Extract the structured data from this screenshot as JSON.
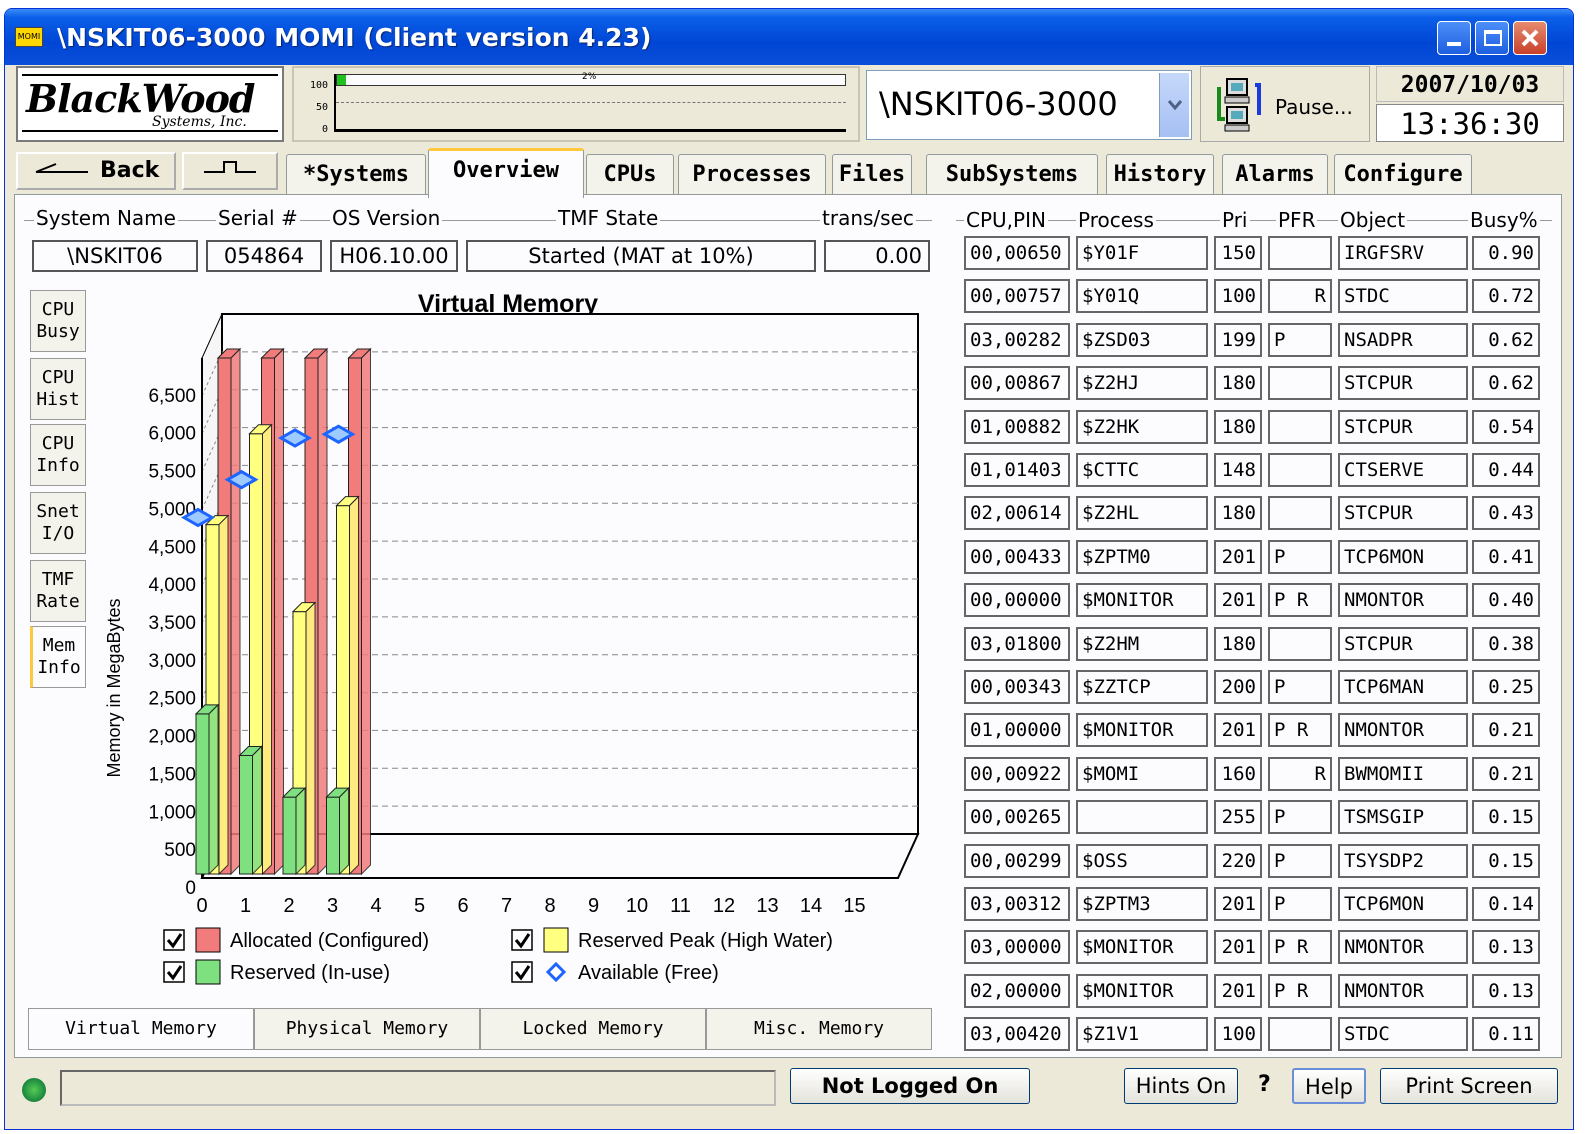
{
  "window": {
    "title": "\\NSKIT06-3000 MOMI (Client version 4.23)"
  },
  "logo": {
    "text": "BlackWood",
    "sub": "Systems, Inc."
  },
  "mini_chart": {
    "yticks": [
      "100",
      "50",
      "0"
    ],
    "label": "2%"
  },
  "system_select": {
    "value": "\\NSKIT06-3000"
  },
  "pause_button": {
    "label": "Pause..."
  },
  "clock": {
    "date": "2007/10/03",
    "time": "13:36:30"
  },
  "nav": {
    "back": "Back",
    "forward": ""
  },
  "tabs": [
    "*Systems",
    "Overview",
    "CPUs",
    "Processes",
    "Files",
    "SubSystems",
    "History",
    "Alarms",
    "Configure"
  ],
  "active_tab": "Overview",
  "summary": {
    "headers": {
      "system_name": "System Name",
      "serial": "Serial #",
      "os_version": "OS Version",
      "tmf_state": "TMF State",
      "trans_sec": "trans/sec"
    },
    "values": {
      "system_name": "\\NSKIT06",
      "serial": "054864",
      "os_version": "H06.10.00",
      "tmf_state": "Started (MAT at 10%)",
      "trans_sec": "0.00"
    }
  },
  "side_tabs": [
    {
      "l1": "CPU",
      "l2": "Busy"
    },
    {
      "l1": "CPU",
      "l2": "Hist"
    },
    {
      "l1": "CPU",
      "l2": "Info"
    },
    {
      "l1": "Snet",
      "l2": "I/O"
    },
    {
      "l1": "TMF",
      "l2": "Rate"
    },
    {
      "l1": "Mem",
      "l2": "Info"
    }
  ],
  "chart_data": {
    "type": "bar",
    "title": "Virtual Memory",
    "ylabel": "Memory in MegaBytes",
    "xlabel": "",
    "categories": [
      "0",
      "1",
      "2",
      "3",
      "4",
      "5",
      "6",
      "7",
      "8",
      "9",
      "10",
      "11",
      "12",
      "13",
      "14",
      "15"
    ],
    "ylim": [
      0,
      7000
    ],
    "yticks": [
      "0",
      "500",
      "1,000",
      "1,500",
      "2,000",
      "2,500",
      "3,000",
      "3,500",
      "4,000",
      "4,500",
      "5,000",
      "5,500",
      "6,000",
      "6,500"
    ],
    "grid": true,
    "series": [
      {
        "name": "Allocated (Configured)",
        "color": "#f27b7b",
        "values": [
          7000,
          7000,
          7000,
          7000
        ]
      },
      {
        "name": "Reserved Peak (High Water)",
        "color": "#ffff80",
        "values": [
          4800,
          6000,
          3650,
          5050
        ]
      },
      {
        "name": "Reserved (In-use)",
        "color": "#7ee07e",
        "values": [
          2300,
          1750,
          1200,
          1200
        ]
      },
      {
        "name": "Available (Free)",
        "color": "#1e64ff",
        "values": [
          4550,
          5050,
          5600,
          5650
        ]
      }
    ],
    "legend": [
      {
        "label": "Allocated (Configured)",
        "checked": true
      },
      {
        "label": "Reserved Peak (High Water)",
        "checked": true
      },
      {
        "label": "Reserved (In-use)",
        "checked": true
      },
      {
        "label": "Available (Free)",
        "checked": true
      }
    ]
  },
  "memory_tabs": [
    "Virtual Memory",
    "Physical Memory",
    "Locked Memory",
    "Misc. Memory"
  ],
  "process_table": {
    "columns": [
      "CPU,PIN",
      "Process",
      "Pri",
      "PFR",
      "Object",
      "Busy%"
    ],
    "rows": [
      [
        "00,00650",
        "$Y01F",
        "150",
        "",
        "IRGFSRV",
        "0.90"
      ],
      [
        "00,00757",
        "$Y01Q",
        "100",
        "R",
        "STDC",
        "0.72"
      ],
      [
        "03,00282",
        "$ZSD03",
        "199",
        "P",
        "NSADPR",
        "0.62"
      ],
      [
        "00,00867",
        "$Z2HJ",
        "180",
        "",
        "STCPUR",
        "0.62"
      ],
      [
        "01,00882",
        "$Z2HK",
        "180",
        "",
        "STCPUR",
        "0.54"
      ],
      [
        "01,01403",
        "$CTTC",
        "148",
        "",
        "CTSERVE",
        "0.44"
      ],
      [
        "02,00614",
        "$Z2HL",
        "180",
        "",
        "STCPUR",
        "0.43"
      ],
      [
        "00,00433",
        "$ZPTM0",
        "201",
        "P",
        "TCP6MON",
        "0.41"
      ],
      [
        "00,00000",
        "$MONITOR",
        "201",
        "P R",
        "NMONTOR",
        "0.40"
      ],
      [
        "03,01800",
        "$Z2HM",
        "180",
        "",
        "STCPUR",
        "0.38"
      ],
      [
        "00,00343",
        "$ZZTCP",
        "200",
        "P",
        "TCP6MAN",
        "0.25"
      ],
      [
        "01,00000",
        "$MONITOR",
        "201",
        "P R",
        "NMONTOR",
        "0.21"
      ],
      [
        "00,00922",
        "$MOMI",
        "160",
        "R",
        "BWMOMII",
        "0.21"
      ],
      [
        "00,00265",
        "",
        "255",
        "P",
        "TSMSGIP",
        "0.15"
      ],
      [
        "00,00299",
        "$OSS",
        "220",
        "P",
        "TSYSDP2",
        "0.15"
      ],
      [
        "03,00312",
        "$ZPTM3",
        "201",
        "P",
        "TCP6MON",
        "0.14"
      ],
      [
        "03,00000",
        "$MONITOR",
        "201",
        "P R",
        "NMONTOR",
        "0.13"
      ],
      [
        "02,00000",
        "$MONITOR",
        "201",
        "P R",
        "NMONTOR",
        "0.13"
      ],
      [
        "03,00420",
        "$Z1V1",
        "100",
        "",
        "STDC",
        "0.11"
      ]
    ]
  },
  "status_bar": {
    "login": "Not Logged On",
    "hints": "Hints On",
    "question": "?",
    "help": "Help",
    "print": "Print Screen"
  }
}
